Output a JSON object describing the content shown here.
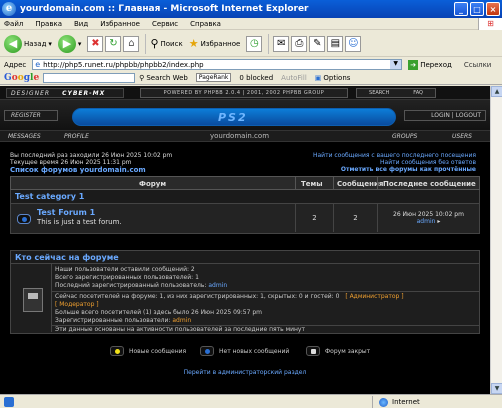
{
  "window": {
    "title": "yourdomain.com :: Главная - Microsoft Internet Explorer"
  },
  "menu": [
    "Файл",
    "Правка",
    "Вид",
    "Избранное",
    "Сервис",
    "Справка"
  ],
  "toolbar": {
    "back": "Назад",
    "search": "Поиск",
    "favorites": "Избранное"
  },
  "address": {
    "label": "Адрес",
    "url": "http://php5.runet.ru/phpbb/phpbb2/index.php",
    "go": "Переход",
    "links": "Ссылки"
  },
  "googlebar": {
    "logo": "Google",
    "search_web": "Search Web",
    "pagerank": "PageRank",
    "blocked": "0 blocked",
    "autofill": "AutoFill",
    "options": "Options"
  },
  "header": {
    "designer": "DESIGNER",
    "cyber": "CYBER-MX",
    "powered": "POWERED BY PHPBB 2.0.4 | 2001, 2002 PHPBB GROUP",
    "search": "SEARCH",
    "faq": "FAQ",
    "register": "REGISTER",
    "login": "LOGIN | LOGOUT",
    "logo": "PS2",
    "nav": {
      "messages": "MESSAGES",
      "profile": "PROFILE",
      "site": "yourdomain.com",
      "groups": "GROUPS",
      "users": "USERS"
    }
  },
  "info": {
    "last_visit": "Вы последний раз заходили 26 Июн 2025 10:02 pm",
    "current_time": "Текущее время 26 Июн 2025 11:31 pm",
    "forum_list": "Список форумов yourdomain.com",
    "link_new_posts": "Найти сообщения с вашего последнего посещения",
    "link_unanswered": "Найти сообщения без ответов",
    "link_mark_read": "Отметить все форумы как прочтённые"
  },
  "table": {
    "headers": {
      "forum": "Форум",
      "topics": "Темы",
      "posts": "Сообщения",
      "last_post": "Последнее сообщение"
    },
    "category": "Test category 1",
    "rows": [
      {
        "name": "Test Forum 1",
        "description": "This is just a test forum.",
        "topics": "2",
        "posts": "2",
        "last_date": "26 Июн 2025 10:02 pm",
        "last_user": "admin"
      }
    ]
  },
  "online": {
    "title": "Кто сейчас на форуме",
    "posts_line": "Наши пользователи оставили сообщений: 2",
    "users_line": "Всего зарегистрированных пользователей: 1",
    "last_user_prefix": "Последний зарегистрированный пользователь: ",
    "last_user": "admin",
    "visitors_line": "Сейчас посетителей на форуме: 1, из них зарегистрированных: 1, скрытых: 0 и гостей: 0",
    "admin_label": "[ Администратор ]",
    "mod_label": "[ Модератор ]",
    "record_line": "Больше всего посетителей (1) здесь было 26 Июн 2025 09:57 pm",
    "registered_prefix": "Зарегистрированные пользователи: ",
    "registered_user": "admin",
    "note": "Эти данные основаны на активности пользователей за последние пять минут"
  },
  "legend": {
    "new": "Новые сообщения",
    "none": "Нет новых сообщений",
    "locked": "Форум закрыт"
  },
  "admin_link": "Перейти в администраторский раздел",
  "status": {
    "zone": "Internet"
  }
}
